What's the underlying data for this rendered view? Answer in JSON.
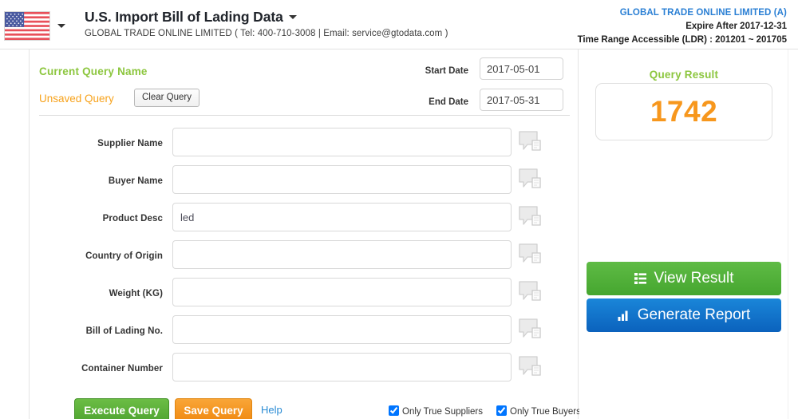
{
  "header": {
    "flag_icon": "us-flag-icon",
    "flag_caret_icon": "chevron-down-icon",
    "title": "U.S. Import Bill of Lading Data",
    "title_caret_icon": "chevron-down-icon",
    "company_line": "GLOBAL TRADE ONLINE LIMITED ( Tel: 400-710-3008  |  Email: service@gtodata.com )",
    "account": "GLOBAL TRADE ONLINE LIMITED (A)",
    "expire": "Expire After 2017-12-31",
    "time_range": "Time Range Accessible (LDR) : 201201 ~ 201705",
    "account_color": "#2a7fd4"
  },
  "query": {
    "current_query_name_label": "Current Query Name",
    "current_query_name_color": "#8cc63e",
    "unsaved_label": "Unsaved Query",
    "unsaved_color": "#f7a21b",
    "clear_button": "Clear Query"
  },
  "dates": {
    "start_label": "Start Date",
    "start_value": "2017-05-01",
    "end_label": "End Date",
    "end_value": "2017-05-31"
  },
  "fields": [
    {
      "label": "Supplier Name",
      "value": "",
      "name": "supplier-name",
      "icon": "comment-document-icon"
    },
    {
      "label": "Buyer Name",
      "value": "",
      "name": "buyer-name",
      "icon": "comment-document-icon"
    },
    {
      "label": "Product Desc",
      "value": "led",
      "name": "product-desc",
      "icon": "comment-document-icon"
    },
    {
      "label": "Country of Origin",
      "value": "",
      "name": "country-of-origin",
      "icon": "comment-document-icon"
    },
    {
      "label": "Weight (KG)",
      "value": "",
      "name": "weight-kg",
      "icon": "comment-document-icon"
    },
    {
      "label": "Bill of Lading No.",
      "value": "",
      "name": "bill-of-lading-no",
      "icon": "comment-document-icon"
    },
    {
      "label": "Container Number",
      "value": "",
      "name": "container-number",
      "icon": "comment-document-icon"
    }
  ],
  "actions": {
    "execute_label": "Execute Query",
    "save_label": "Save Query",
    "help_label": "Help",
    "execute_color": "#4fa531",
    "save_color": "#f08a12",
    "help_color": "#2a8bd4"
  },
  "checkboxes": [
    {
      "label": "Only True Suppliers",
      "checked": true,
      "name": "only-true-suppliers"
    },
    {
      "label": "Only True Buyers",
      "checked": true,
      "name": "only-true-buyers"
    }
  ],
  "sidebar": {
    "result_title": "Query Result",
    "result_title_color": "#8cc63e",
    "result_count": "1742",
    "result_count_color": "#f7971d",
    "view_result_label": "View Result",
    "view_result_icon": "list-icon",
    "view_result_color": "#45a62f",
    "generate_report_label": "Generate Report",
    "generate_report_icon": "bar-chart-icon",
    "generate_report_color": "#0b62bd"
  }
}
